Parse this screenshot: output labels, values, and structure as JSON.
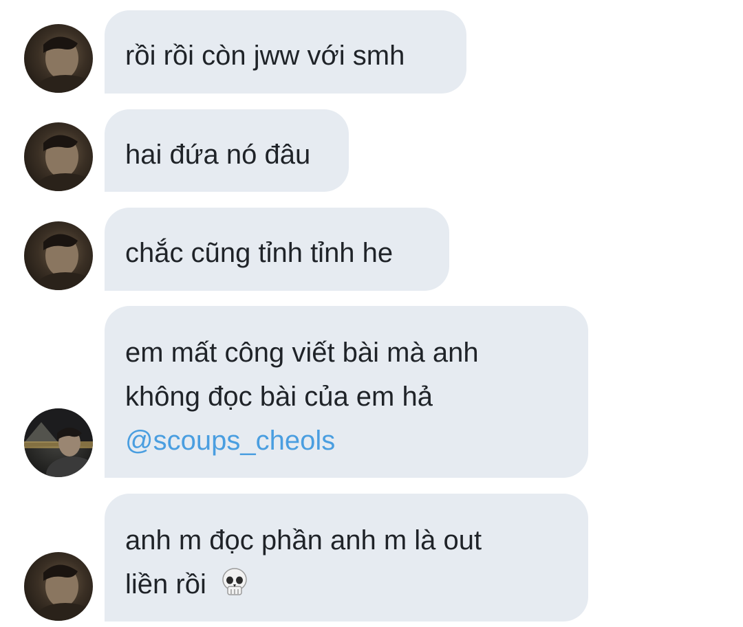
{
  "messages": [
    {
      "lines": [
        "rồi rồi còn jww với smh"
      ],
      "avatar": "avatar-dark-portrait"
    },
    {
      "lines": [
        "hai đứa nó đâu"
      ],
      "avatar": "avatar-dark-portrait"
    },
    {
      "lines": [
        "chắc cũng tỉnh tỉnh he"
      ],
      "avatar": "avatar-dark-portrait"
    },
    {
      "lines": [
        "em mất công viết bài mà anh",
        "không đọc bài của em hả"
      ],
      "mention": "@scoups_cheols",
      "avatar": "avatar-louvre-night"
    },
    {
      "lines": [
        "anh m đọc phần anh m là out",
        "liền rồi"
      ],
      "emoji": "skull-icon",
      "avatar": "avatar-dark-portrait"
    }
  ],
  "colors": {
    "bubble": "#e6ebf1",
    "text": "#1f2328",
    "mention": "#4a9ee0",
    "background": "#ffffff"
  }
}
